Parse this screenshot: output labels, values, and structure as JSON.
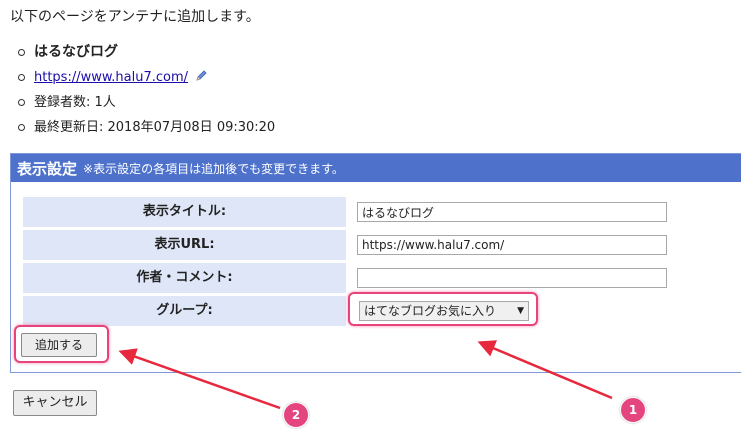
{
  "intro": "以下のページをアンテナに追加します。",
  "site": {
    "name": "はるなびログ",
    "url": "https://www.halu7.com/",
    "subscribers": "登録者数: 1人",
    "last_updated": "最終更新日: 2018年07月08日 09:30:20"
  },
  "settings": {
    "title": "表示設定",
    "note": "※表示設定の各項目は追加後でも変更できます。",
    "fields": {
      "display_title": {
        "label": "表示タイトル:",
        "value": "はるなびログ"
      },
      "display_url": {
        "label": "表示URL:",
        "value": "https://www.halu7.com/"
      },
      "author_comment": {
        "label": "作者・コメント:",
        "value": ""
      },
      "group": {
        "label": "グループ:",
        "selected": "はてなブログお気に入り"
      }
    },
    "add_button": "追加する"
  },
  "cancel_button": "キャンセル",
  "annotations": {
    "badge_1": "1",
    "badge_2": "2"
  },
  "colors": {
    "header": "#4e72cc",
    "label_bg": "#dfe6f7",
    "highlight": "#e8437a"
  }
}
